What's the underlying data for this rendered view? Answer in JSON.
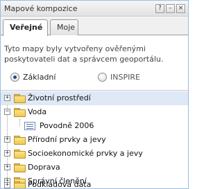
{
  "panel": {
    "title": "Mapové kompozice",
    "tools": {
      "help": "?",
      "minimize": "–",
      "close": "×"
    }
  },
  "tabs": [
    {
      "label": "Veřejné",
      "active": true
    },
    {
      "label": "Moje",
      "active": false
    }
  ],
  "description": "Tyto mapy byly vytvořeny ověřenými poskytovateli dat a správcem geoportálu.",
  "sources": [
    {
      "label": "Základní",
      "checked": true
    },
    {
      "label": "INSPIRE",
      "checked": false
    }
  ],
  "tree": [
    {
      "label": "Životní prostředí",
      "expanded": false
    },
    {
      "label": "Voda",
      "expanded": true,
      "children": [
        {
          "label": "Povodně 2006"
        }
      ]
    },
    {
      "label": "Přírodní prvky a jevy",
      "expanded": false
    },
    {
      "label": "Socioekonomické prvky a jevy",
      "expanded": false
    },
    {
      "label": "Doprava",
      "expanded": false
    },
    {
      "label": "Správní členění",
      "expanded": false
    },
    {
      "label": "Podkladová data",
      "expanded": false
    }
  ],
  "colors": {
    "panel_border": "#99bbe8",
    "selected_row": "#dfe8f6",
    "folder": "#f0c850"
  }
}
